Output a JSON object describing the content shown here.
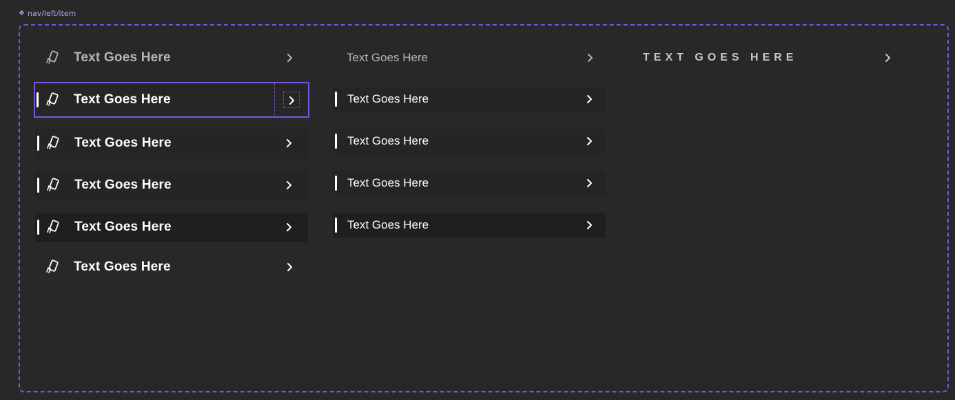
{
  "component_label": {
    "icon": "component-diamond-icon",
    "text": "nav/left/item"
  },
  "colors": {
    "background": "#282828",
    "accent": "#7b55e0",
    "text_primary": "#ffffff",
    "text_muted": "#b4b4b4"
  },
  "column_icon_variant": {
    "items": [
      {
        "label": "Text Goes Here",
        "state": "default",
        "icon": "cards-icon",
        "chevron": "chevron-right-icon"
      },
      {
        "label": "Text Goes Here",
        "state": "selected",
        "icon": "cards-icon",
        "chevron": "chevron-right-icon"
      },
      {
        "label": "Text Goes Here",
        "state": "hover",
        "icon": "cards-icon",
        "chevron": "chevron-right-icon"
      },
      {
        "label": "Text Goes Here",
        "state": "active",
        "icon": "cards-icon",
        "chevron": "chevron-right-icon"
      },
      {
        "label": "Text Goes Here",
        "state": "pressed",
        "icon": "cards-icon",
        "chevron": "chevron-right-icon"
      },
      {
        "label": "Text Goes Here",
        "state": "plain",
        "icon": "cards-icon",
        "chevron": "chevron-right-icon"
      }
    ]
  },
  "column_text_variant": {
    "items": [
      {
        "label": "Text Goes Here",
        "state": "default",
        "chevron": "chevron-right-icon"
      },
      {
        "label": "Text Goes Here",
        "state": "hover",
        "chevron": "chevron-right-icon"
      },
      {
        "label": "Text Goes Here",
        "state": "active",
        "chevron": "chevron-right-icon"
      },
      {
        "label": "Text Goes Here",
        "state": "focused",
        "chevron": "chevron-right-icon"
      },
      {
        "label": "Text Goes Here",
        "state": "pressed",
        "chevron": "chevron-right-icon"
      }
    ]
  },
  "column_caps_variant": {
    "items": [
      {
        "label": "TEXT GOES HERE",
        "state": "default",
        "chevron": "chevron-right-icon"
      }
    ]
  }
}
